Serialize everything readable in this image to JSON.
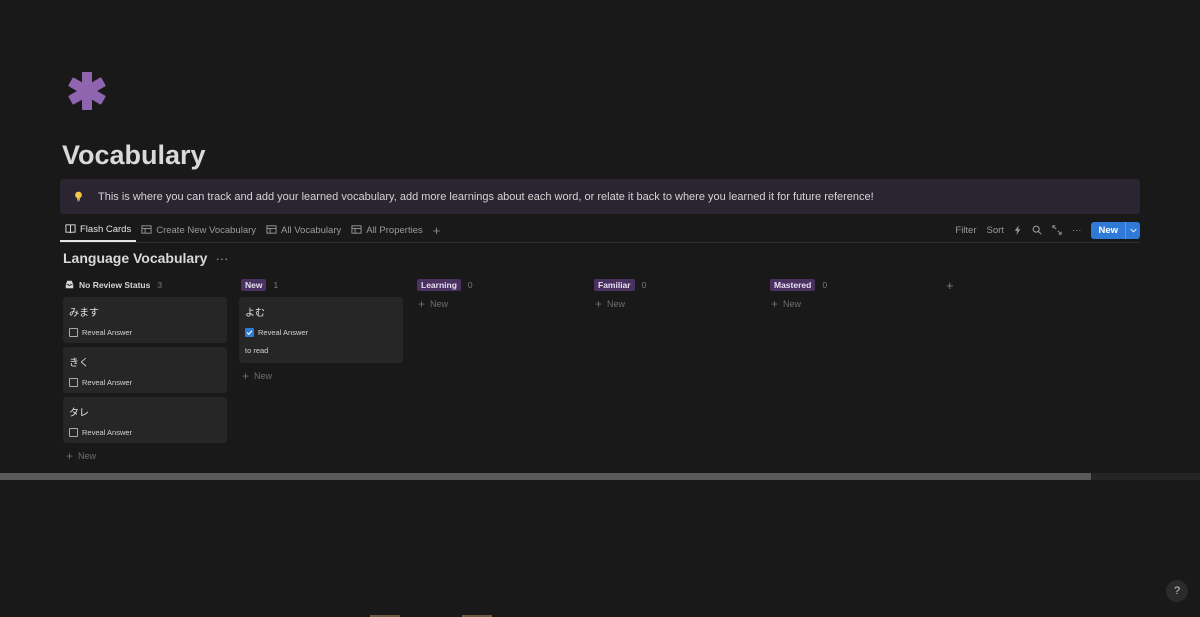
{
  "page": {
    "title": "Vocabulary",
    "icon": "asterisk-icon",
    "accent": "#9065b0"
  },
  "callout": {
    "icon": "lightbulb-icon",
    "text": "This is where you can track and add your learned vocabulary, add more learnings about each word, or relate it back to where you learned it for future reference!"
  },
  "tabs": [
    {
      "label": "Flash Cards",
      "icon": "book-icon",
      "active": true
    },
    {
      "label": "Create New Vocabulary",
      "icon": "table-icon",
      "active": false
    },
    {
      "label": "All Vocabulary",
      "icon": "table-icon",
      "active": false
    },
    {
      "label": "All Properties",
      "icon": "table-icon",
      "active": false
    }
  ],
  "toolbar": {
    "filter": "Filter",
    "sort": "Sort",
    "new": "New"
  },
  "database": {
    "title": "Language Vocabulary",
    "more": "···"
  },
  "board": {
    "add_label": "New",
    "checkbox_label": "Reveal Answer",
    "columns": [
      {
        "name": "No Review Status",
        "count": "3",
        "cards": [
          {
            "word": "みます",
            "checked": false,
            "answer": ""
          },
          {
            "word": "きく",
            "checked": false,
            "answer": ""
          },
          {
            "word": "タレ",
            "checked": false,
            "answer": ""
          }
        ]
      },
      {
        "name": "New",
        "count": "1",
        "cards": [
          {
            "word": "よむ",
            "checked": true,
            "answer": "to read"
          }
        ]
      },
      {
        "name": "Learning",
        "count": "0",
        "cards": []
      },
      {
        "name": "Familiar",
        "count": "0",
        "cards": []
      },
      {
        "name": "Mastered",
        "count": "0",
        "cards": []
      }
    ]
  },
  "help": "?"
}
